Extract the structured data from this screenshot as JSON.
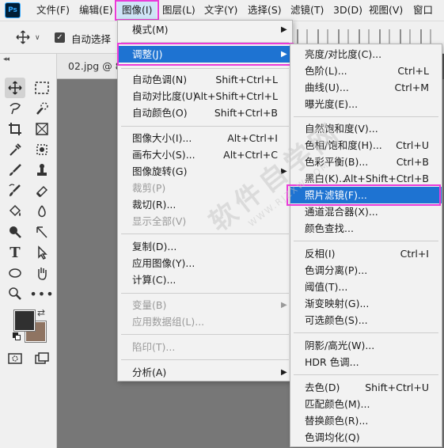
{
  "app": {
    "logo_text": "Ps"
  },
  "menubar": {
    "items": [
      {
        "label": "文件(F)"
      },
      {
        "label": "编辑(E)"
      },
      {
        "label": "图像(I)"
      },
      {
        "label": "图层(L)"
      },
      {
        "label": "文字(Y)"
      },
      {
        "label": "选择(S)"
      },
      {
        "label": "滤镜(T)"
      },
      {
        "label": "3D(D)"
      },
      {
        "label": "视图(V)"
      },
      {
        "label": "窗口"
      }
    ]
  },
  "options_bar": {
    "auto_select_label": "自动选择",
    "auto_select_checked": true
  },
  "document": {
    "tab_label": "02.jpg @ 8"
  },
  "image_menu": {
    "items": [
      {
        "label": "模式(M)",
        "shortcut": "",
        "submenu": true
      },
      {
        "label": "调整(J)",
        "shortcut": "",
        "submenu": true
      },
      {
        "label": "自动色调(N)",
        "shortcut": "Shift+Ctrl+L"
      },
      {
        "label": "自动对比度(U)",
        "shortcut": "Alt+Shift+Ctrl+L"
      },
      {
        "label": "自动颜色(O)",
        "shortcut": "Shift+Ctrl+B"
      },
      {
        "label": "图像大小(I)...",
        "shortcut": "Alt+Ctrl+I"
      },
      {
        "label": "画布大小(S)...",
        "shortcut": "Alt+Ctrl+C"
      },
      {
        "label": "图像旋转(G)",
        "shortcut": "",
        "submenu": true
      },
      {
        "label": "裁剪(P)",
        "shortcut": "",
        "disabled": true
      },
      {
        "label": "裁切(R)...",
        "shortcut": ""
      },
      {
        "label": "显示全部(V)",
        "shortcut": "",
        "disabled": true
      },
      {
        "label": "复制(D)...",
        "shortcut": ""
      },
      {
        "label": "应用图像(Y)...",
        "shortcut": ""
      },
      {
        "label": "计算(C)...",
        "shortcut": ""
      },
      {
        "label": "变量(B)",
        "shortcut": "",
        "submenu": true,
        "disabled": true
      },
      {
        "label": "应用数据组(L)...",
        "shortcut": "",
        "disabled": true
      },
      {
        "label": "陷印(T)...",
        "shortcut": "",
        "disabled": true
      },
      {
        "label": "分析(A)",
        "shortcut": "",
        "submenu": true
      }
    ]
  },
  "adjust_menu": {
    "items": [
      {
        "label": "亮度/对比度(C)...",
        "shortcut": ""
      },
      {
        "label": "色阶(L)...",
        "shortcut": "Ctrl+L"
      },
      {
        "label": "曲线(U)...",
        "shortcut": "Ctrl+M"
      },
      {
        "label": "曝光度(E)...",
        "shortcut": ""
      },
      {
        "label": "自然饱和度(V)...",
        "shortcut": ""
      },
      {
        "label": "色相/饱和度(H)...",
        "shortcut": "Ctrl+U"
      },
      {
        "label": "色彩平衡(B)...",
        "shortcut": "Ctrl+B"
      },
      {
        "label": "黑白(K)...",
        "shortcut": "Alt+Shift+Ctrl+B"
      },
      {
        "label": "照片滤镜(F)...",
        "shortcut": ""
      },
      {
        "label": "通道混合器(X)...",
        "shortcut": ""
      },
      {
        "label": "颜色查找...",
        "shortcut": ""
      },
      {
        "label": "反相(I)",
        "shortcut": "Ctrl+I"
      },
      {
        "label": "色调分离(P)...",
        "shortcut": ""
      },
      {
        "label": "阈值(T)...",
        "shortcut": ""
      },
      {
        "label": "渐变映射(G)...",
        "shortcut": ""
      },
      {
        "label": "可选颜色(S)...",
        "shortcut": ""
      },
      {
        "label": "阴影/高光(W)...",
        "shortcut": ""
      },
      {
        "label": "HDR 色调...",
        "shortcut": ""
      },
      {
        "label": "去色(D)",
        "shortcut": "Shift+Ctrl+U"
      },
      {
        "label": "匹配颜色(M)...",
        "shortcut": ""
      },
      {
        "label": "替换颜色(R)...",
        "shortcut": ""
      },
      {
        "label": "色调均化(Q)",
        "shortcut": ""
      }
    ]
  },
  "colors": {
    "highlight": "#1e73d2",
    "annotation_box": "#ea3bd9",
    "foreground": "#303030",
    "background": "#8f7462"
  },
  "watermark": {
    "text": "软件自学网",
    "subtext": "WWW.RJZXW.COM"
  }
}
